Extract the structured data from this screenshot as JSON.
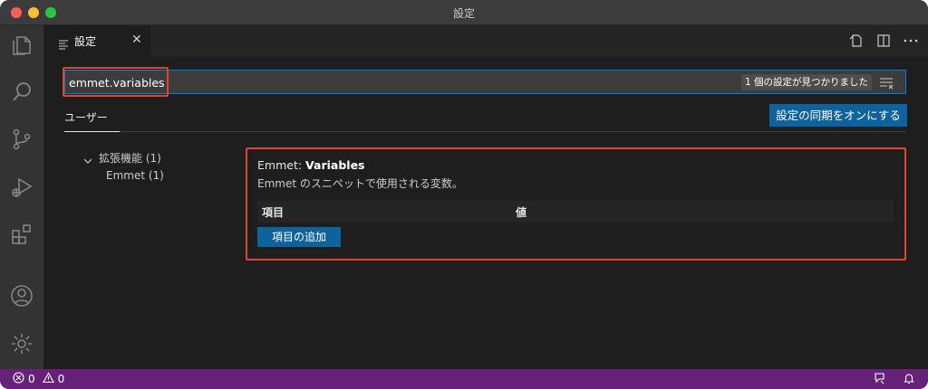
{
  "window": {
    "title": "設定"
  },
  "tabs": [
    {
      "label": "設定",
      "close": "✕"
    }
  ],
  "search": {
    "value": "emmet.variables",
    "result_count": "1 個の設定が見つかりました"
  },
  "scope": {
    "active_tab": "ユーザー",
    "sync_button": "設定の同期をオンにする"
  },
  "toc": {
    "groups": [
      {
        "label": "拡張機能 (1)",
        "children": [
          {
            "label": "Emmet (1)"
          }
        ]
      }
    ]
  },
  "setting": {
    "category": "Emmet: ",
    "name": "Variables",
    "description": "Emmet のスニペットで使用される変数。",
    "table": {
      "col_item": "項目",
      "col_value": "値"
    },
    "add_button": "項目の追加"
  },
  "statusbar": {
    "errors": "0",
    "warnings": "0"
  },
  "colors": {
    "accent": "#0e639c",
    "statusbar": "#68217a",
    "highlight": "#e0452c",
    "focus_border": "#007fd4"
  }
}
